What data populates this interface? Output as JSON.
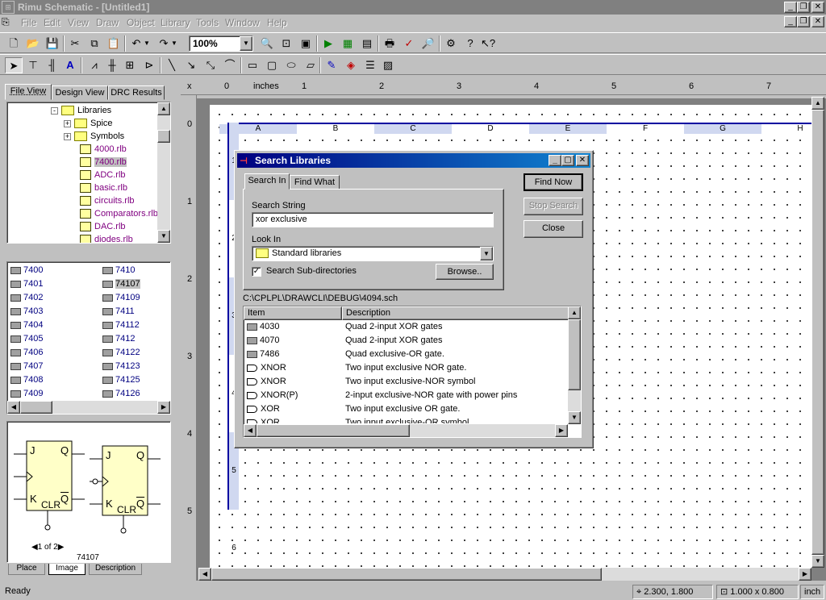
{
  "window": {
    "title": "Rimu Schematic - [Untitled1]"
  },
  "menu": [
    "File",
    "Edit",
    "View",
    "Draw",
    "Object",
    "Library",
    "Tools",
    "Window",
    "Help"
  ],
  "toolbar": {
    "zoom": "100%"
  },
  "left_panel": {
    "tabs": [
      "File View",
      "Design View",
      "DRC Results"
    ],
    "tree": [
      {
        "label": "Libraries",
        "kind": "folder",
        "expander": "-",
        "indent": 0
      },
      {
        "label": "Spice",
        "kind": "folder",
        "expander": "+",
        "indent": 1
      },
      {
        "label": "Symbols",
        "kind": "folder",
        "expander": "+",
        "indent": 1
      },
      {
        "label": "4000.rlb",
        "kind": "lib",
        "indent": 1
      },
      {
        "label": "7400.rlb",
        "kind": "lib",
        "indent": 1,
        "selected": true
      },
      {
        "label": "ADC.rlb",
        "kind": "lib",
        "indent": 1
      },
      {
        "label": "basic.rlb",
        "kind": "lib",
        "indent": 1
      },
      {
        "label": "circuits.rlb",
        "kind": "lib",
        "indent": 1
      },
      {
        "label": "Comparators.rlb",
        "kind": "lib",
        "indent": 1
      },
      {
        "label": "DAC.rlb",
        "kind": "lib",
        "indent": 1
      },
      {
        "label": "diodes.rlb",
        "kind": "lib",
        "indent": 1
      }
    ],
    "parts_col1": [
      "7400",
      "7401",
      "7402",
      "7403",
      "7404",
      "7405",
      "7406",
      "7407",
      "7408",
      "7409"
    ],
    "parts_col2": [
      "7410",
      "74107",
      "74109",
      "7411",
      "74112",
      "7412",
      "74122",
      "74123",
      "74125",
      "74126"
    ],
    "selected_part": "74107",
    "preview": {
      "pager": "1 of 2",
      "part_name": "74107",
      "pin_j": "J",
      "pin_q": "Q",
      "pin_k": "K",
      "pin_clr": "CLR"
    },
    "bottom_tabs": [
      "Place",
      "Image",
      "Description"
    ]
  },
  "ruler": {
    "unit": "inches",
    "x_marks": [
      "0",
      "1",
      "2",
      "3",
      "4",
      "5",
      "6",
      "7"
    ],
    "y_marks": [
      "0",
      "1",
      "2",
      "3",
      "4",
      "5"
    ],
    "columns": [
      "A",
      "B",
      "C",
      "D",
      "E",
      "F",
      "G",
      "H"
    ],
    "rows": [
      "1",
      "2",
      "3",
      "4",
      "5",
      "6"
    ],
    "corner": "x"
  },
  "dialog": {
    "title": "Search Libraries",
    "tabs": [
      "Search In",
      "Find What"
    ],
    "search_string_label": "Search String",
    "search_string": "xor exclusive",
    "look_in_label": "Look In",
    "look_in": "Standard libraries",
    "subdirs_label": "Search Sub-directories",
    "subdirs_checked": true,
    "browse": "Browse..",
    "find_now": "Find Now",
    "stop_search": "Stop Search",
    "close": "Close",
    "path": "C:\\CPLPL\\DRAWCLI\\DEBUG\\4094.sch",
    "columns": [
      "Item",
      "Description"
    ],
    "results": [
      {
        "item": "4030",
        "desc": "Quad 2-input XOR gates",
        "kind": "chip"
      },
      {
        "item": "4070",
        "desc": "Quad 2-input XOR gates",
        "kind": "chip"
      },
      {
        "item": "7486",
        "desc": "Quad exclusive-OR gate.",
        "kind": "chip"
      },
      {
        "item": "XNOR",
        "desc": "Two input exclusive NOR gate.",
        "kind": "gate"
      },
      {
        "item": "XNOR",
        "desc": "Two input exclusive-NOR symbol",
        "kind": "gate"
      },
      {
        "item": "XNOR(P)",
        "desc": "2-input exclusive-NOR gate with power pins",
        "kind": "gate"
      },
      {
        "item": "XOR",
        "desc": "Two input exclusive OR gate.",
        "kind": "gate"
      },
      {
        "item": "XOR",
        "desc": "Two input exclusive-OR symbol",
        "kind": "gate"
      }
    ]
  },
  "status": {
    "text": "Ready",
    "coords": "2.300, 1.800",
    "size": "1.000 x 0.800",
    "unit": "inch"
  }
}
